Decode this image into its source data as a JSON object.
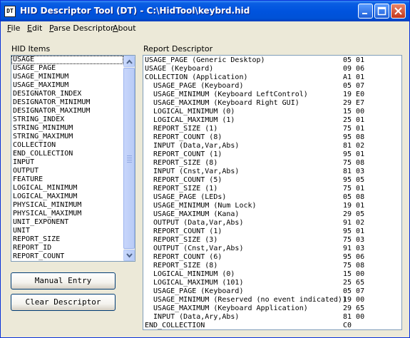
{
  "window": {
    "title": "HID Descriptor Tool (DT) - C:\\HidTool\\keybrd.hid",
    "icon_text": "DT"
  },
  "menu": [
    "File",
    "Edit",
    "Parse Descriptor",
    "About"
  ],
  "hid_items": {
    "label": "HID Items",
    "items": [
      "USAGE",
      "USAGE_PAGE",
      "USAGE_MINIMUM",
      "USAGE_MAXIMUM",
      "DESIGNATOR_INDEX",
      "DESIGNATOR_MINIMUM",
      "DESIGNATOR_MAXIMUM",
      "STRING_INDEX",
      "STRING_MINIMUM",
      "STRING_MAXIMUM",
      "COLLECTION",
      "END_COLLECTION",
      "INPUT",
      "OUTPUT",
      "FEATURE",
      "LOGICAL_MINIMUM",
      "LOGICAL_MAXIMUM",
      "PHYSICAL_MINIMUM",
      "PHYSICAL_MAXIMUM",
      "UNIT_EXPONENT",
      "UNIT",
      "REPORT_SIZE",
      "REPORT_ID",
      "REPORT_COUNT"
    ],
    "selected": "USAGE"
  },
  "buttons": {
    "manual_entry": "Manual Entry",
    "clear_descriptor": "Clear Descriptor"
  },
  "report_descriptor": {
    "label": "Report Descriptor",
    "rows": [
      {
        "text": "USAGE_PAGE (Generic Desktop)",
        "bytes": "05 01"
      },
      {
        "text": "USAGE (Keyboard)",
        "bytes": "09 06"
      },
      {
        "text": "COLLECTION (Application)",
        "bytes": "A1 01"
      },
      {
        "text": "  USAGE_PAGE (Keyboard)",
        "bytes": "05 07"
      },
      {
        "text": "  USAGE_MINIMUM (Keyboard LeftControl)",
        "bytes": "19 E0"
      },
      {
        "text": "  USAGE_MAXIMUM (Keyboard Right GUI)",
        "bytes": "29 E7"
      },
      {
        "text": "  LOGICAL_MINIMUM (0)",
        "bytes": "15 00"
      },
      {
        "text": "  LOGICAL_MAXIMUM (1)",
        "bytes": "25 01"
      },
      {
        "text": "  REPORT_SIZE (1)",
        "bytes": "75 01"
      },
      {
        "text": "  REPORT_COUNT (8)",
        "bytes": "95 08"
      },
      {
        "text": "  INPUT (Data,Var,Abs)",
        "bytes": "81 02"
      },
      {
        "text": "  REPORT_COUNT (1)",
        "bytes": "95 01"
      },
      {
        "text": "  REPORT_SIZE (8)",
        "bytes": "75 08"
      },
      {
        "text": "  INPUT (Cnst,Var,Abs)",
        "bytes": "81 03"
      },
      {
        "text": "  REPORT_COUNT (5)",
        "bytes": "95 05"
      },
      {
        "text": "  REPORT_SIZE (1)",
        "bytes": "75 01"
      },
      {
        "text": "  USAGE_PAGE (LEDs)",
        "bytes": "05 08"
      },
      {
        "text": "  USAGE_MINIMUM (Num Lock)",
        "bytes": "19 01"
      },
      {
        "text": "  USAGE_MAXIMUM (Kana)",
        "bytes": "29 05"
      },
      {
        "text": "  OUTPUT (Data,Var,Abs)",
        "bytes": "91 02"
      },
      {
        "text": "  REPORT_COUNT (1)",
        "bytes": "95 01"
      },
      {
        "text": "  REPORT_SIZE (3)",
        "bytes": "75 03"
      },
      {
        "text": "  OUTPUT (Cnst,Var,Abs)",
        "bytes": "91 03"
      },
      {
        "text": "  REPORT_COUNT (6)",
        "bytes": "95 06"
      },
      {
        "text": "  REPORT_SIZE (8)",
        "bytes": "75 08"
      },
      {
        "text": "  LOGICAL_MINIMUM (0)",
        "bytes": "15 00"
      },
      {
        "text": "  LOGICAL_MAXIMUM (101)",
        "bytes": "25 65"
      },
      {
        "text": "  USAGE_PAGE (Keyboard)",
        "bytes": "05 07"
      },
      {
        "text": "  USAGE_MINIMUM (Reserved (no event indicated))",
        "bytes": "19 00"
      },
      {
        "text": "  USAGE_MAXIMUM (Keyboard Application)",
        "bytes": "29 65"
      },
      {
        "text": "  INPUT (Data,Ary,Abs)",
        "bytes": "81 00"
      },
      {
        "text": "END_COLLECTION",
        "bytes": "C0"
      }
    ]
  }
}
